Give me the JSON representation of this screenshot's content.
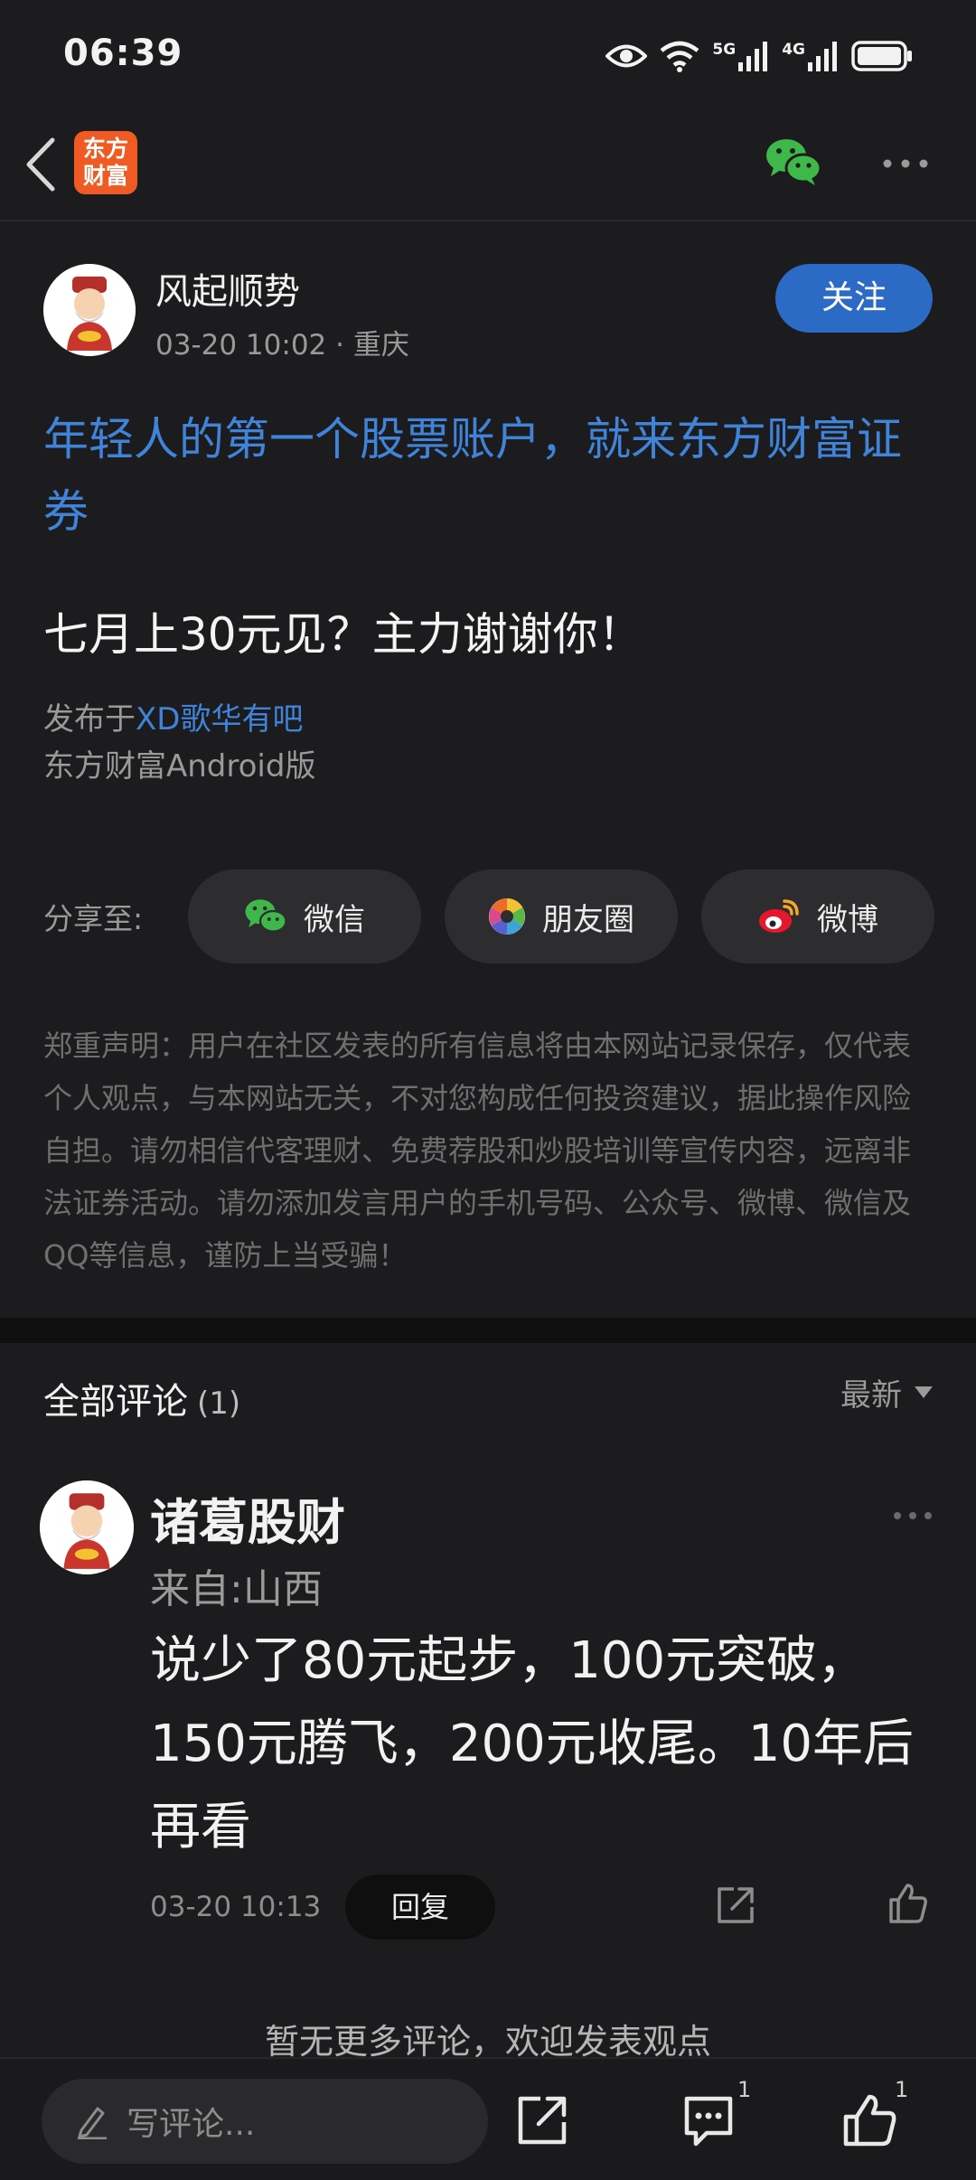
{
  "status_bar": {
    "time": "06:39",
    "net1": "5G",
    "net2": "4G"
  },
  "nav": {
    "logo_line1": "东方",
    "logo_line2": "财富"
  },
  "post": {
    "author": "风起顺势",
    "meta": "03-20 10:02 · 重庆",
    "follow": "关注",
    "ad": "年轻人的第一个股票账户，就来东方财富证券",
    "title": "七月上30元见？主力谢谢你！",
    "published_prefix": "发布于",
    "bar_name": "XD歌华有吧",
    "client": "东方财富Android版"
  },
  "share": {
    "label": "分享至:",
    "wechat": "微信",
    "moments": "朋友圈",
    "weibo": "微博"
  },
  "disclaimer": "郑重声明：用户在社区发表的所有信息将由本网站记录保存，仅代表个人观点，与本网站无关，不对您构成任何投资建议，据此操作风险自担。请勿相信代客理财、免费荐股和炒股培训等宣传内容，远离非法证券活动。请勿添加发言用户的手机号码、公众号、微博、微信及QQ等信息，谨防上当受骗！",
  "comments": {
    "title": "全部评论",
    "count": "(1)",
    "sort": "最新",
    "items": [
      {
        "name": "诸葛股财",
        "from": "来自:山西",
        "body": "说少了80元起步，100元突破，150元腾飞，200元收尾。10年后再看",
        "time": "03-20 10:13",
        "reply": "回复"
      }
    ],
    "no_more": "暂无更多评论，欢迎发表观点"
  },
  "bottom": {
    "placeholder": "写评论...",
    "comment_count": "1",
    "like_count": "1"
  },
  "colors": {
    "accent": "#3f84d8",
    "follow": "#2c6bc5",
    "brand": "#f05a23",
    "wechat": "#3fb84a"
  }
}
